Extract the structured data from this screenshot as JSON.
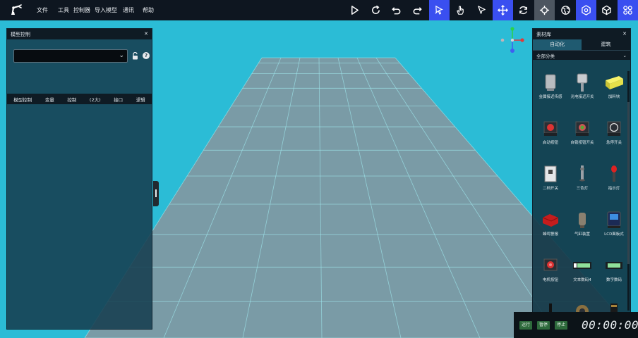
{
  "menu": [
    "文件",
    "工具",
    "控制器",
    "导入模型",
    "通讯",
    "帮助"
  ],
  "toolbar": {
    "icons": [
      "play-icon",
      "reload-icon",
      "undo-icon",
      "redo-icon",
      "select-cursor-icon",
      "hand-cursor-icon",
      "pointer-icon",
      "move-icon",
      "rotate-icon",
      "scale-icon",
      "globe-icon",
      "settings-icon",
      "cube-icon",
      "grid-apps-icon"
    ],
    "active_color": "#3a4ff0"
  },
  "left_panel": {
    "title": "模型控制",
    "select_value": "",
    "tabs": [
      "模型控制",
      "变量",
      "控制",
      "(2大)",
      "接口",
      "逻辑"
    ]
  },
  "right_panel": {
    "title": "素材库",
    "tabs": [
      "自动化",
      "建筑"
    ],
    "active_tab": "自动化",
    "category": "全部分类",
    "components": [
      {
        "label": "金属接近传感",
        "icon": "metal-sensor-icon"
      },
      {
        "label": "光电接近开关",
        "icon": "photo-sensor-icon"
      },
      {
        "label": "加料块",
        "icon": "material-block-icon"
      },
      {
        "label": "启动按钮",
        "icon": "start-button-icon"
      },
      {
        "label": "自锁按钮开关",
        "icon": "latch-button-icon"
      },
      {
        "label": "急停开关",
        "icon": "estop-switch-icon"
      },
      {
        "label": "二档开关",
        "icon": "selector-switch-icon"
      },
      {
        "label": "三色灯",
        "icon": "tower-light-icon"
      },
      {
        "label": "指示灯",
        "icon": "indicator-light-icon"
      },
      {
        "label": "蜂鸣警报",
        "icon": "buzzer-icon"
      },
      {
        "label": "气缸装置",
        "icon": "cylinder-icon"
      },
      {
        "label": "LCD面板式",
        "icon": "lcd-panel-icon"
      },
      {
        "label": "电机按钮",
        "icon": "motor-button-icon"
      },
      {
        "label": "文本数码4",
        "icon": "digit-display-icon"
      },
      {
        "label": "数字数码",
        "icon": "number-display-icon"
      },
      {
        "label": "",
        "icon": "rod-icon"
      },
      {
        "label": "",
        "icon": "gear-icon"
      },
      {
        "label": "",
        "icon": "post-icon"
      }
    ]
  },
  "sim": {
    "buttons": [
      "运行",
      "暂停",
      "停止"
    ],
    "timer": "00:00:00"
  }
}
